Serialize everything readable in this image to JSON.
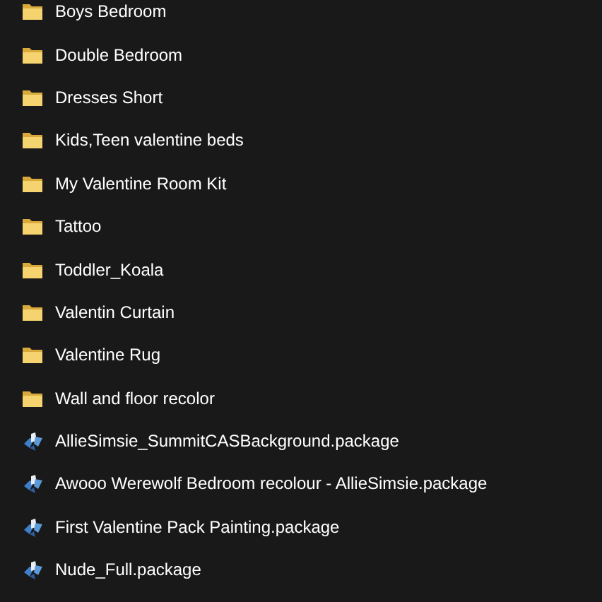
{
  "items": [
    {
      "kind": "folder",
      "name": "Boys Bedroom"
    },
    {
      "kind": "folder",
      "name": "Double Bedroom"
    },
    {
      "kind": "folder",
      "name": "Dresses Short"
    },
    {
      "kind": "folder",
      "name": "Kids,Teen valentine beds"
    },
    {
      "kind": "folder",
      "name": "My Valentine Room Kit"
    },
    {
      "kind": "folder",
      "name": "Tattoo"
    },
    {
      "kind": "folder",
      "name": "Toddler_Koala"
    },
    {
      "kind": "folder",
      "name": "Valentin Curtain"
    },
    {
      "kind": "folder",
      "name": "Valentine Rug"
    },
    {
      "kind": "folder",
      "name": "Wall and floor recolor"
    },
    {
      "kind": "package",
      "name": "AllieSimsie_SummitCASBackground.package"
    },
    {
      "kind": "package",
      "name": "Awooo Werewolf Bedroom recolour - AllieSimsie.package"
    },
    {
      "kind": "package",
      "name": "First Valentine Pack Painting.package"
    },
    {
      "kind": "package",
      "name": "Nude_Full.package"
    }
  ]
}
